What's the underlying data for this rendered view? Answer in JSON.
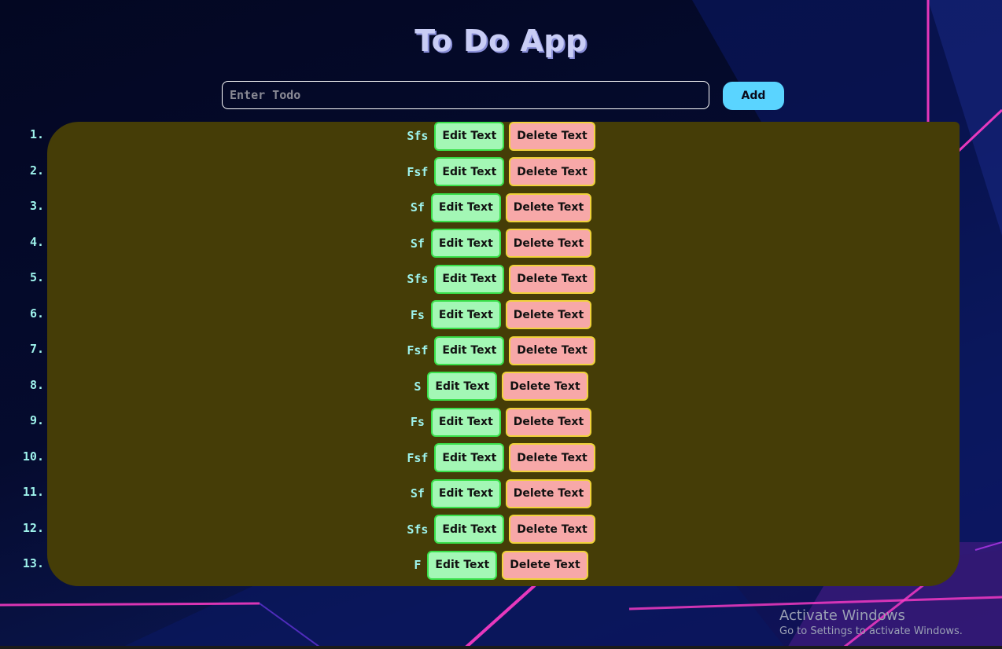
{
  "app": {
    "title": "To Do App"
  },
  "input": {
    "placeholder": "Enter Todo",
    "value": "",
    "add_label": "Add"
  },
  "colors": {
    "panel": "#453d07",
    "edit_bg": "#a3f7b5",
    "edit_border": "#39e04a",
    "delete_bg": "#f7a8a8",
    "delete_border": "#f0d23a",
    "add_bg": "#5ad4ff",
    "item_text": "#9ef3ec"
  },
  "todos": [
    {
      "number": "1.",
      "text": "Sfs",
      "edit_label": "Edit Text",
      "delete_label": "Delete Text"
    },
    {
      "number": "2.",
      "text": "Fsf",
      "edit_label": "Edit Text",
      "delete_label": "Delete Text"
    },
    {
      "number": "3.",
      "text": "Sf",
      "edit_label": "Edit Text",
      "delete_label": "Delete Text"
    },
    {
      "number": "4.",
      "text": "Sf",
      "edit_label": "Edit Text",
      "delete_label": "Delete Text"
    },
    {
      "number": "5.",
      "text": "Sfs",
      "edit_label": "Edit Text",
      "delete_label": "Delete Text"
    },
    {
      "number": "6.",
      "text": "Fs",
      "edit_label": "Edit Text",
      "delete_label": "Delete Text"
    },
    {
      "number": "7.",
      "text": "Fsf",
      "edit_label": "Edit Text",
      "delete_label": "Delete Text"
    },
    {
      "number": "8.",
      "text": "S",
      "edit_label": "Edit Text",
      "delete_label": "Delete Text"
    },
    {
      "number": "9.",
      "text": "Fs",
      "edit_label": "Edit Text",
      "delete_label": "Delete Text"
    },
    {
      "number": "10.",
      "text": "Fsf",
      "edit_label": "Edit Text",
      "delete_label": "Delete Text"
    },
    {
      "number": "11.",
      "text": "Sf",
      "edit_label": "Edit Text",
      "delete_label": "Delete Text"
    },
    {
      "number": "12.",
      "text": "Sfs",
      "edit_label": "Edit Text",
      "delete_label": "Delete Text"
    },
    {
      "number": "13.",
      "text": "F",
      "edit_label": "Edit Text",
      "delete_label": "Delete Text"
    }
  ],
  "watermark": {
    "title": "Activate Windows",
    "subtitle": "Go to Settings to activate Windows."
  }
}
